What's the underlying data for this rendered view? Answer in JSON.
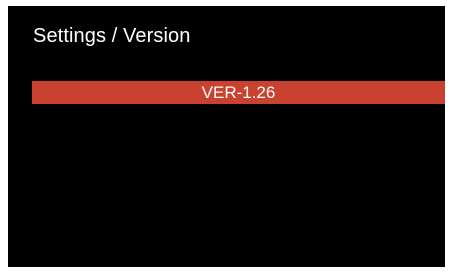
{
  "header": {
    "title": "Settings / Version"
  },
  "menu": {
    "selected_item": "VER-1.26"
  },
  "colors": {
    "background": "#000000",
    "text": "#ffffff",
    "highlight": "#c8422f"
  }
}
